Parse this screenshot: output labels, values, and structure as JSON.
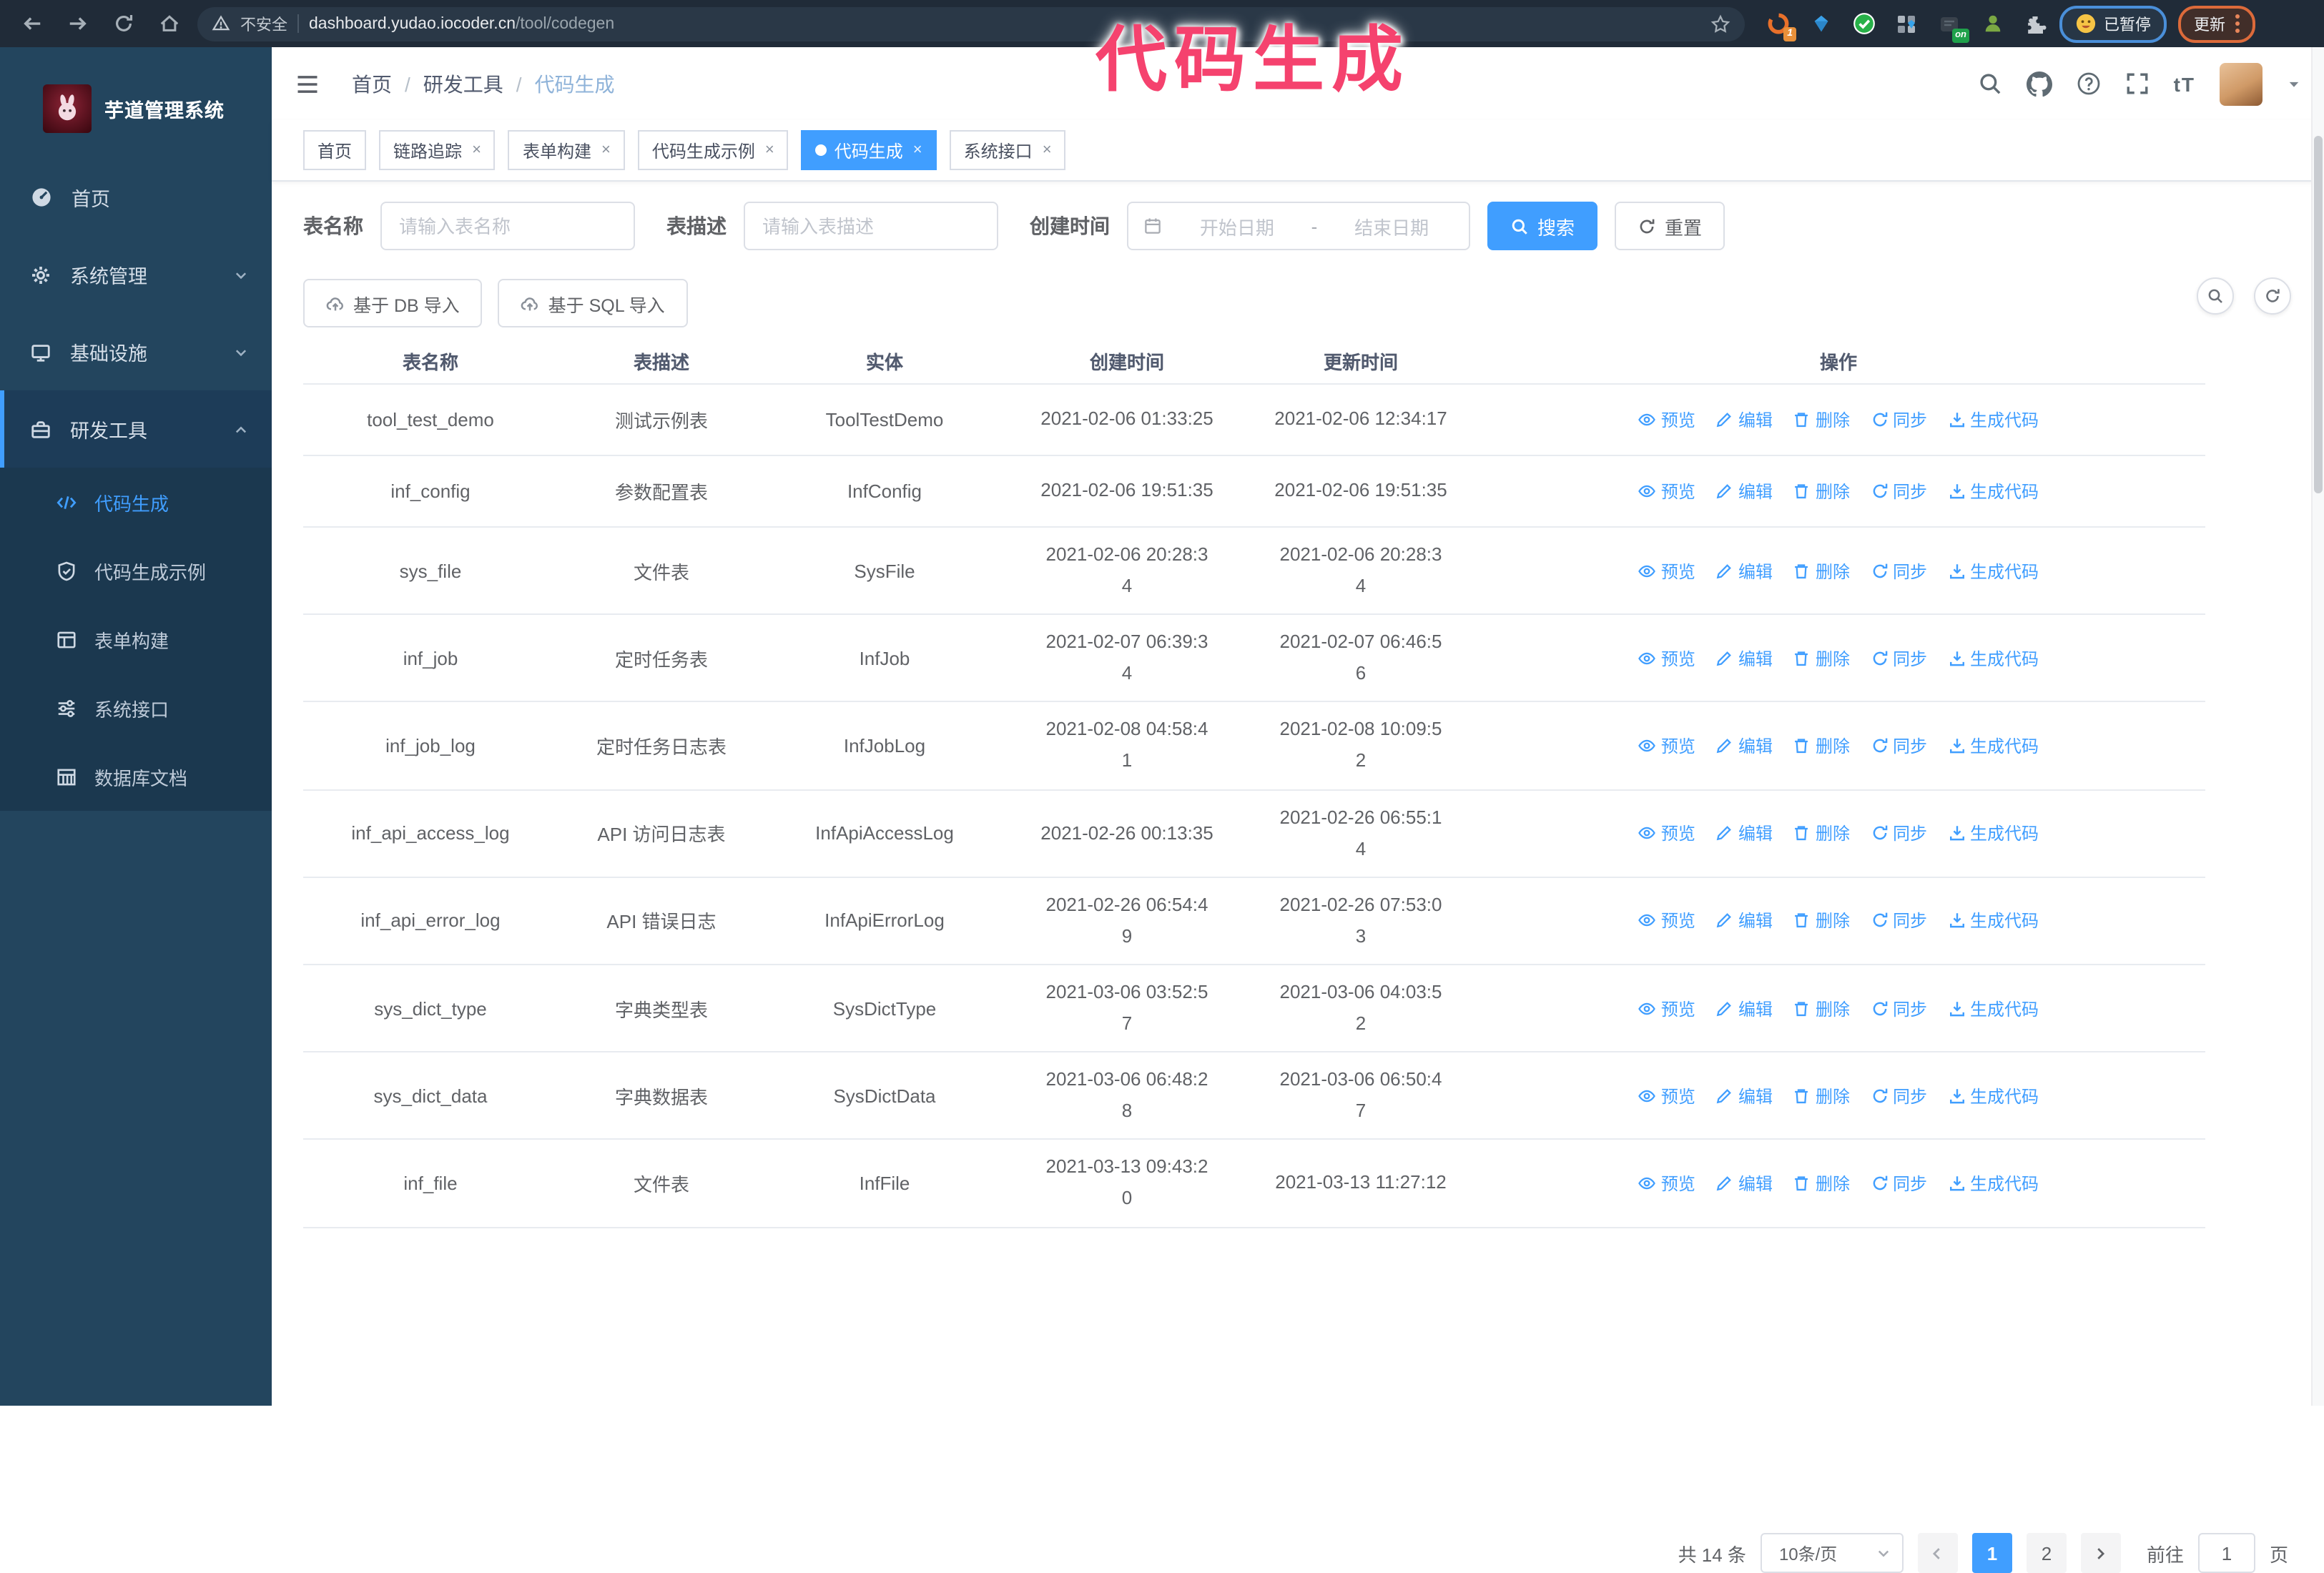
{
  "annotation": {
    "text": "代码生成"
  },
  "browser": {
    "security_label": "不安全",
    "url_host": "dashboard.yudao.iocoder.cn",
    "url_path": "/tool/codegen",
    "ext_count_badge": "1",
    "ext_on_badge": "on",
    "paused_badge": "已暂停",
    "update_button": "更新"
  },
  "sidebar": {
    "app_title": "芋道管理系统",
    "items": [
      {
        "icon": "dashboard-icon",
        "label": "首页"
      },
      {
        "icon": "gear-icon",
        "label": "系统管理",
        "chevron": "down"
      },
      {
        "icon": "infra-icon",
        "label": "基础设施",
        "chevron": "down"
      },
      {
        "icon": "tools-icon",
        "label": "研发工具",
        "chevron": "up",
        "active": true,
        "children": [
          {
            "icon": "code-icon",
            "label": "代码生成",
            "active": true
          },
          {
            "icon": "example-icon",
            "label": "代码生成示例"
          },
          {
            "icon": "form-icon",
            "label": "表单构建"
          },
          {
            "icon": "api-icon",
            "label": "系统接口"
          },
          {
            "icon": "dbdoc-icon",
            "label": "数据库文档"
          }
        ]
      }
    ]
  },
  "header": {
    "breadcrumb": [
      "首页",
      "研发工具",
      "代码生成"
    ]
  },
  "tabs": [
    {
      "label": "首页",
      "closable": false,
      "active": false
    },
    {
      "label": "链路追踪",
      "closable": true,
      "active": false
    },
    {
      "label": "表单构建",
      "closable": true,
      "active": false
    },
    {
      "label": "代码生成示例",
      "closable": true,
      "active": false
    },
    {
      "label": "代码生成",
      "closable": true,
      "active": true
    },
    {
      "label": "系统接口",
      "closable": true,
      "active": false
    }
  ],
  "filters": {
    "name_label": "表名称",
    "name_placeholder": "请输入表名称",
    "desc_label": "表描述",
    "desc_placeholder": "请输入表描述",
    "time_label": "创建时间",
    "start_placeholder": "开始日期",
    "range_separator": "-",
    "end_placeholder": "结束日期",
    "search_label": "搜索",
    "reset_label": "重置"
  },
  "toolbar": {
    "import_db": "基于 DB 导入",
    "import_sql": "基于 SQL 导入"
  },
  "table": {
    "columns": [
      "表名称",
      "表描述",
      "实体",
      "创建时间",
      "更新时间",
      "操作"
    ],
    "rows": [
      {
        "name": "tool_test_demo",
        "desc": "测试示例表",
        "entity": "ToolTestDemo",
        "created": "2021-02-06 01:33:25",
        "updated": "2021-02-06 12:34:17"
      },
      {
        "name": "inf_config",
        "desc": "参数配置表",
        "entity": "InfConfig",
        "created": "2021-02-06 19:51:35",
        "updated": "2021-02-06 19:51:35"
      },
      {
        "name": "sys_file",
        "desc": "文件表",
        "entity": "SysFile",
        "created": "2021-02-06 20:28:3\n4",
        "updated": "2021-02-06 20:28:3\n4"
      },
      {
        "name": "inf_job",
        "desc": "定时任务表",
        "entity": "InfJob",
        "created": "2021-02-07 06:39:3\n4",
        "updated": "2021-02-07 06:46:5\n6"
      },
      {
        "name": "inf_job_log",
        "desc": "定时任务日志表",
        "entity": "InfJobLog",
        "created": "2021-02-08 04:58:4\n1",
        "updated": "2021-02-08 10:09:5\n2"
      },
      {
        "name": "inf_api_access_log",
        "desc": "API 访问日志表",
        "entity": "InfApiAccessLog",
        "created": "2021-02-26 00:13:35",
        "updated": "2021-02-26 06:55:1\n4"
      },
      {
        "name": "inf_api_error_log",
        "desc": "API 错误日志",
        "entity": "InfApiErrorLog",
        "created": "2021-02-26 06:54:4\n9",
        "updated": "2021-02-26 07:53:0\n3"
      },
      {
        "name": "sys_dict_type",
        "desc": "字典类型表",
        "entity": "SysDictType",
        "created": "2021-03-06 03:52:5\n7",
        "updated": "2021-03-06 04:03:5\n2"
      },
      {
        "name": "sys_dict_data",
        "desc": "字典数据表",
        "entity": "SysDictData",
        "created": "2021-03-06 06:48:2\n8",
        "updated": "2021-03-06 06:50:4\n7"
      },
      {
        "name": "inf_file",
        "desc": "文件表",
        "entity": "InfFile",
        "created": "2021-03-13 09:43:2\n0",
        "updated": "2021-03-13 11:27:12"
      }
    ]
  },
  "row_actions": [
    {
      "key": "preview",
      "label": "预览"
    },
    {
      "key": "edit",
      "label": "编辑"
    },
    {
      "key": "delete",
      "label": "删除"
    },
    {
      "key": "sync",
      "label": "同步"
    },
    {
      "key": "generate",
      "label": "生成代码"
    }
  ],
  "pagination": {
    "total": "共 14 条",
    "page_size": "10条/页",
    "pages": [
      "1",
      "2"
    ],
    "active_page": "1",
    "goto_label": "前往",
    "goto_value": "1",
    "goto_suffix": "页"
  },
  "colors": {
    "accent": "#409eff",
    "sidebar_bg": "#23455e",
    "submenu_bg": "#1b384f",
    "annotation_pink": "#f5426e"
  }
}
